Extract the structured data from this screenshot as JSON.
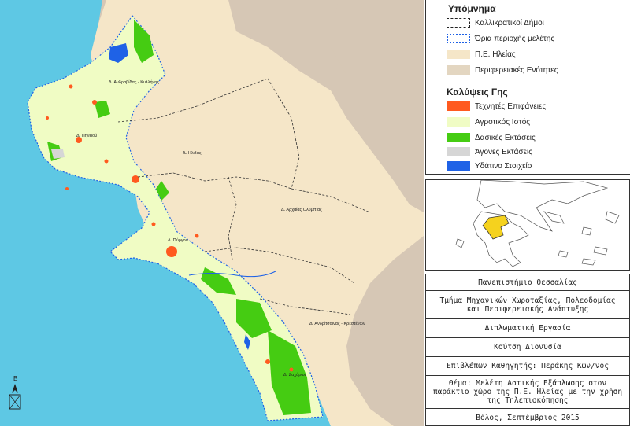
{
  "legend": {
    "title": "Υπόμνημα",
    "items": [
      {
        "label": "Καλλικρατικοί Δήμοι",
        "style": "dashed-black"
      },
      {
        "label": "Όρια περιοχής μελέτης",
        "style": "dotted-blue"
      },
      {
        "label": "Π.Ε. Ηλείας",
        "style": "fill",
        "color": "#f5e6c8"
      },
      {
        "label": "Περιφερειακές Ενότητες",
        "style": "fill",
        "color": "#e3d6c1"
      }
    ],
    "landcover_title": "Καλύψεις Γης",
    "landcover": [
      {
        "label": "Τεχνητές Επιφάνειες",
        "color": "#ff5a1f"
      },
      {
        "label": "Αγροτικός Ιστός",
        "color": "#f0fcc4"
      },
      {
        "label": "Δασικές Εκτάσεις",
        "color": "#45cc12"
      },
      {
        "label": "Άγονες Εκτάσεις",
        "color": "#d6d6d6"
      },
      {
        "label": "Υδάτινο Στοιχείο",
        "color": "#1f62e6"
      }
    ]
  },
  "map": {
    "municipalities": [
      "Δ. Ανδραβίδας - Κυλλήνης",
      "Δ. Πηνειού",
      "Δ. Ηλιδας",
      "Δ. Αρχαίας Ολυμπίας",
      "Δ. Πύργου",
      "Δ. Ανδρίτσαινας - Κρεστένων",
      "Δ. Ζαχάρως"
    ],
    "north_letter": "Β",
    "colors": {
      "sea": "#5ec8e4",
      "land": "#d6c7b5",
      "elia": "#f5e6c8",
      "agri": "#f0fcc4"
    }
  },
  "title_block": {
    "university": "Πανεπιστήμιο Θεσσαλίας",
    "department_line1": "Τμήμα Μηχανικών Χωροταξίας, Πολεοδομίας",
    "department_line2": "και Περιφερειακής Ανάπτυξης",
    "thesis": "Διπλωματική Εργασία",
    "author": "Κούτση Διονυσία",
    "supervisor": "Επιβλέπων Καθηγητής: Περάκης Κων/νος",
    "topic_line1": "Θέμα: Μελέτη Αστικής Εξάπλωσης στον",
    "topic_line2": "παράκτιο χώρο της Π.Ε. Ηλείας με την χρήση",
    "topic_line3": "της Τηλεπισκόπησης",
    "place_date": "Βόλος, Σεπτέμβριος 2015"
  }
}
